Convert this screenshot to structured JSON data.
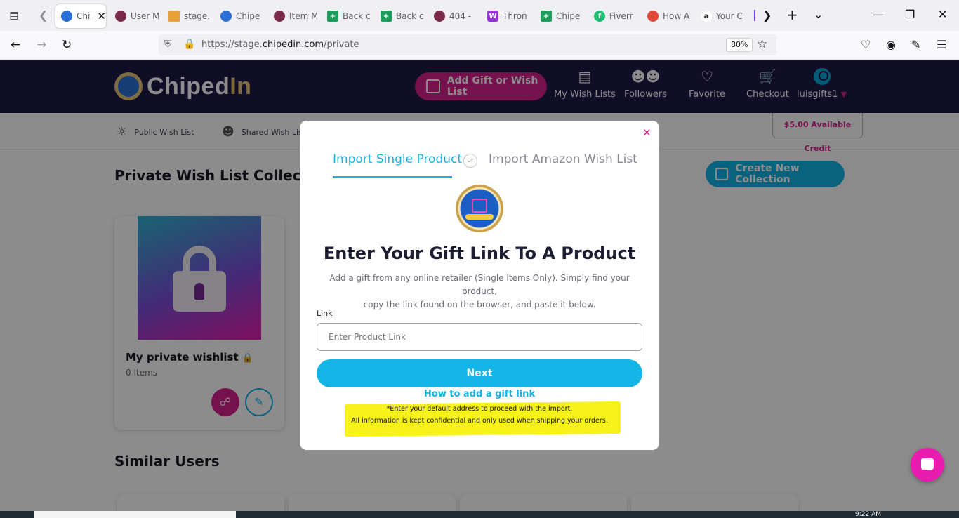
{
  "browser": {
    "tabs": [
      {
        "label": "ChipedIn",
        "favicon": "chipedin-icon",
        "color": "#2a6fd6",
        "active": true
      },
      {
        "label": "User M",
        "favicon": "app-icon",
        "color": "#7a2a4a"
      },
      {
        "label": "stage.",
        "favicon": "pma-icon",
        "color": "#e8a03a"
      },
      {
        "label": "Chipe",
        "favicon": "chipedin-icon",
        "color": "#2a6fd6"
      },
      {
        "label": "Item M",
        "favicon": "app-icon",
        "color": "#7a2a4a"
      },
      {
        "label": "Back c",
        "favicon": "sheets-icon",
        "color": "#1e9e5a"
      },
      {
        "label": "Back c",
        "favicon": "sheets-icon",
        "color": "#1e9e5a"
      },
      {
        "label": "404 -",
        "favicon": "app-icon",
        "color": "#7a2a4a"
      },
      {
        "label": "Thron",
        "favicon": "thron-icon",
        "color": "#9b30d9"
      },
      {
        "label": "Chipe",
        "favicon": "sheets-icon",
        "color": "#1e9e5a"
      },
      {
        "label": "Fiverr",
        "favicon": "fiverr-icon",
        "color": "#1dbf73"
      },
      {
        "label": "How A",
        "favicon": "nbc-icon",
        "color": "#e04a3a"
      },
      {
        "label": "Your C",
        "favicon": "amazon-icon",
        "color": "#222222"
      }
    ],
    "url_prefix": "https://stage.",
    "url_domain": "chipedin.com",
    "url_path": "/private",
    "zoom": "80%"
  },
  "header": {
    "logo_main": "Chiped",
    "logo_accent": "In",
    "add_gift_label": "Add Gift or Wish List",
    "nav": [
      {
        "label": "My Wish Lists",
        "icon": "wishlist-icon"
      },
      {
        "label": "Followers",
        "icon": "followers-icon"
      },
      {
        "label": "Favorite",
        "icon": "heart-icon"
      },
      {
        "label": "Checkout",
        "icon": "cart-icon"
      },
      {
        "label": "luisgifts1",
        "icon": "avatar-icon"
      }
    ]
  },
  "subnav": {
    "items": [
      {
        "label": "Public Wish List",
        "icon": "globe-icon"
      },
      {
        "label": "Shared Wish List",
        "icon": "users-icon"
      }
    ],
    "credit": "$5.00 Available Credit"
  },
  "main": {
    "section_title": "Private Wish List Collection",
    "create_collection": "Create New Collection",
    "wishlist": {
      "title": "My private wishlist",
      "items": "0 Items"
    },
    "similar_users_title": "Similar Users"
  },
  "modal": {
    "tab_single": "Import Single Product",
    "or": "or",
    "tab_amazon": "Import Amazon Wish List",
    "heading": "Enter Your Gift Link To A Product",
    "desc_line1": "Add a gift from any online retailer (Single Items Only). Simply find your product,",
    "desc_line2": "copy the link found on the browser, and paste it below.",
    "link_label": "Link",
    "link_placeholder": "Enter Product Link",
    "link_value": "",
    "next_label": "Next",
    "howto_label": "How to add a gift link",
    "note1": "*Enter your default address to proceed with the import.",
    "note2": "All information is kept confidential and only used when shipping your orders."
  },
  "taskbar": {
    "clock": "9:22 AM"
  },
  "colors": {
    "brand_pink": "#d61f8c",
    "brand_cyan": "#13b4e6",
    "header_bg": "#1e1848"
  }
}
